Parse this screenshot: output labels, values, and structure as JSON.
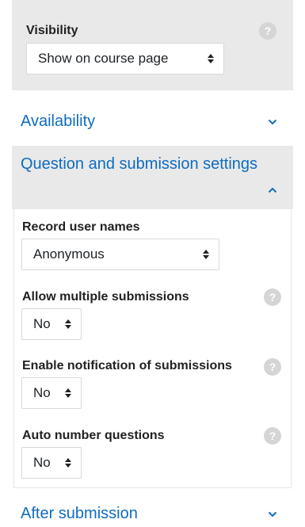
{
  "visibility": {
    "label": "Visibility",
    "help_icon": "?",
    "select_value": "Show on course page"
  },
  "sections": {
    "availability": {
      "title": "Availability",
      "state": "collapsed"
    },
    "question_submission": {
      "title": "Question and submission settings",
      "state": "expanded"
    },
    "after_submission": {
      "title": "After submission",
      "state": "collapsed"
    }
  },
  "fields": {
    "record_user_names": {
      "label": "Record user names",
      "value": "Anonymous"
    },
    "allow_multiple": {
      "label": "Allow multiple submissions",
      "value": "No",
      "help_icon": "?"
    },
    "enable_notification": {
      "label": "Enable notification of submissions",
      "value": "No",
      "help_icon": "?"
    },
    "auto_number": {
      "label": "Auto number questions",
      "value": "No",
      "help_icon": "?"
    }
  },
  "colors": {
    "link_blue": "#0f6cbf",
    "panel_gray": "#e9e9e9",
    "help_gray": "#d5d5d5"
  }
}
